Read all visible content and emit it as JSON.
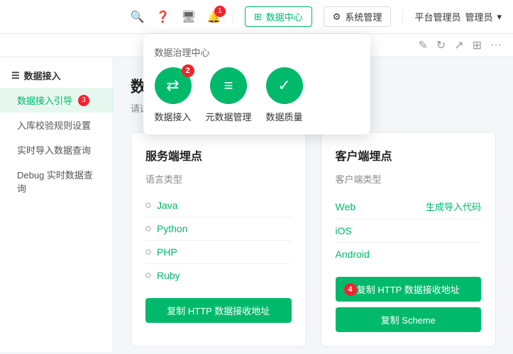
{
  "header": {
    "icons": [
      "search",
      "question",
      "monitor",
      "bell"
    ],
    "notification_count": "1",
    "data_center_label": "数据中心",
    "system_manage_label": "系统管理",
    "user_label": "平台管理员",
    "user_sub": "管理员"
  },
  "dropdown": {
    "title": "数据治理中心",
    "items": [
      {
        "label": "数据接入",
        "badge": "2",
        "icon": "⇄"
      },
      {
        "label": "元数据管理",
        "badge": null,
        "icon": "≡"
      },
      {
        "label": "数据质量",
        "badge": null,
        "icon": "✓"
      }
    ]
  },
  "toolbar": {
    "icons": [
      "edit",
      "refresh",
      "share",
      "grid",
      "more"
    ]
  },
  "sidebar": {
    "group_title": "数据接入",
    "items": [
      {
        "label": "数据接入引导",
        "active": true,
        "badge": "3"
      },
      {
        "label": "入库校验规则设置",
        "active": false,
        "badge": null
      },
      {
        "label": "实时导入数据查询",
        "active": false,
        "badge": null
      },
      {
        "label": "Debug 实时数据查询",
        "active": false,
        "badge": null
      }
    ]
  },
  "main": {
    "title": "数据接入引导",
    "subtitle": "请选择以下数据接入方式",
    "server_section": {
      "title": "服务端埋点",
      "subtitle": "语言类型",
      "languages": [
        {
          "label": "Java"
        },
        {
          "label": "Python"
        },
        {
          "label": "PHP"
        },
        {
          "label": "Ruby"
        }
      ],
      "btn_label": "复制 HTTP 数据接收地址"
    },
    "client_section": {
      "title": "客户端埋点",
      "subtitle": "客户端类型",
      "clients": [
        {
          "label": "Web",
          "action": "生成导入代码"
        },
        {
          "label": "iOS",
          "action": null
        },
        {
          "label": "Android",
          "action": null
        }
      ],
      "btn_label": "复制 HTTP 数据接收地址",
      "btn_badge": "4",
      "btn2_label": "复制 Scheme"
    }
  }
}
